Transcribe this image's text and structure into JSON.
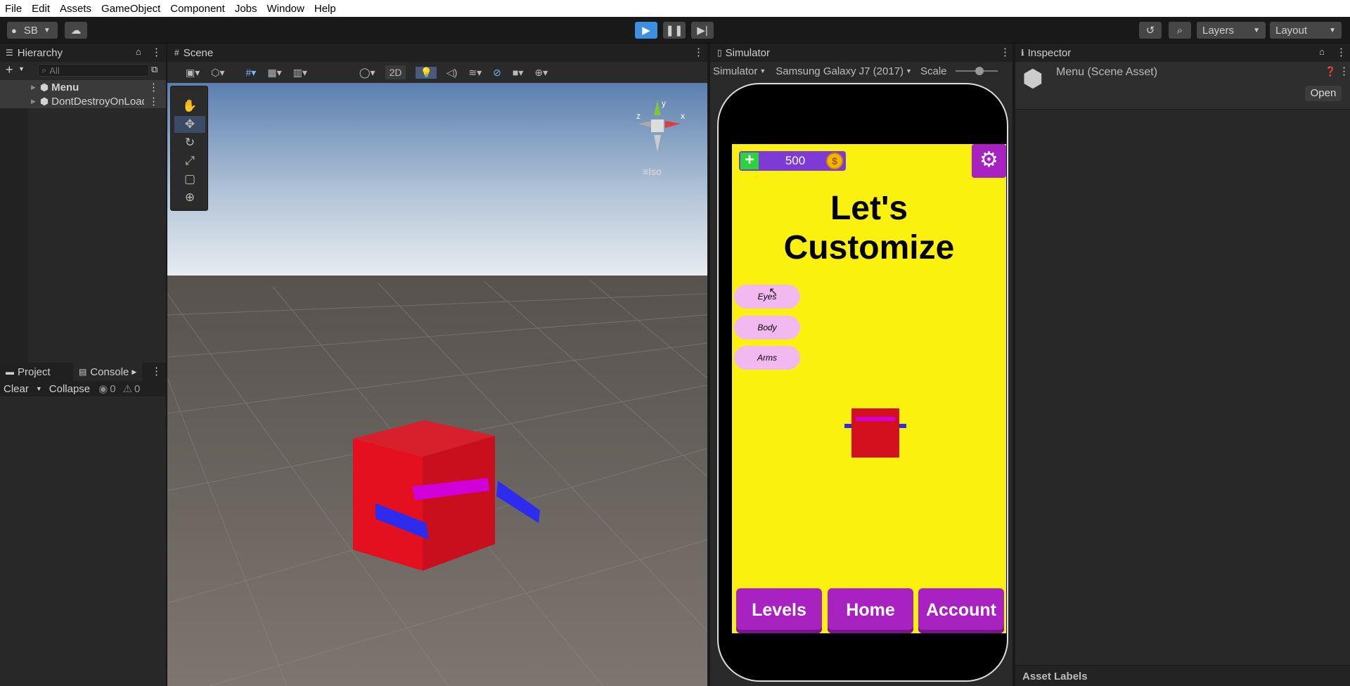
{
  "menu": [
    "File",
    "Edit",
    "Assets",
    "GameObject",
    "Component",
    "Jobs",
    "Window",
    "Help"
  ],
  "toolbar": {
    "account": "SB",
    "layers": "Layers",
    "layout": "Layout"
  },
  "hierarchy": {
    "title": "Hierarchy",
    "search_placeholder": "All",
    "items": [
      {
        "label": "Menu"
      },
      {
        "label": "DontDestroyOnLoad"
      }
    ]
  },
  "scene": {
    "title": "Scene",
    "mode_2d": "2D",
    "gizmo_axis": "y",
    "gizmo_x": "x",
    "gizmo_z": "z",
    "projection": "Iso"
  },
  "project": {
    "tab_project": "Project",
    "tab_console": "Console",
    "clear": "Clear",
    "collapse": "Collapse",
    "errors": "0",
    "warnings": "0"
  },
  "simulator": {
    "title": "Simulator",
    "mode": "Simulator",
    "device": "Samsung Galaxy J7 (2017)",
    "scale": "Scale"
  },
  "game": {
    "coins": "500",
    "heading_line1": "Let's",
    "heading_line2": "Customize",
    "categories": [
      "Eyes",
      "Body",
      "Arms"
    ],
    "nav": [
      "Levels",
      "Home",
      "Account"
    ]
  },
  "inspector": {
    "title": "Inspector",
    "asset_name": "Menu (Scene Asset)",
    "open": "Open",
    "asset_labels": "Asset Labels"
  },
  "colors": {
    "game_bg": "#fbf10f",
    "purple": "#a822c1",
    "coin_bar": "#7d3ad6",
    "cube": "#d4101f",
    "arm": "#2d2cee",
    "accent_blue": "#3d8fdf"
  }
}
